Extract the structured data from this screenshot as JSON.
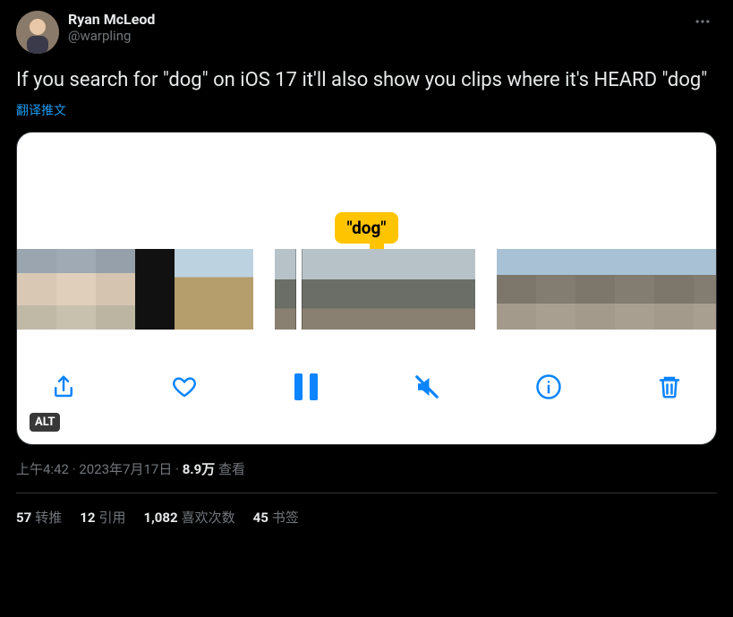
{
  "author": {
    "display_name": "Ryan McLeod",
    "handle": "@warpling"
  },
  "body": "If you search for \"dog\" on iOS 17 it'll also show you clips where it's HEARD \"dog\"",
  "translate_label": "翻译推文",
  "media": {
    "caption_bubble": "\"dog\"",
    "alt_badge": "ALT"
  },
  "meta": {
    "time": "上午4:42",
    "dot1": " · ",
    "date": "2023年7月17日",
    "dot2": " · ",
    "views_value": "8.9万",
    "views_label": " 查看"
  },
  "stats": {
    "retweets_value": "57",
    "retweets_label": "转推",
    "quotes_value": "12",
    "quotes_label": "引用",
    "likes_value": "1,082",
    "likes_label": "喜欢次数",
    "bookmarks_value": "45",
    "bookmarks_label": "书签"
  }
}
